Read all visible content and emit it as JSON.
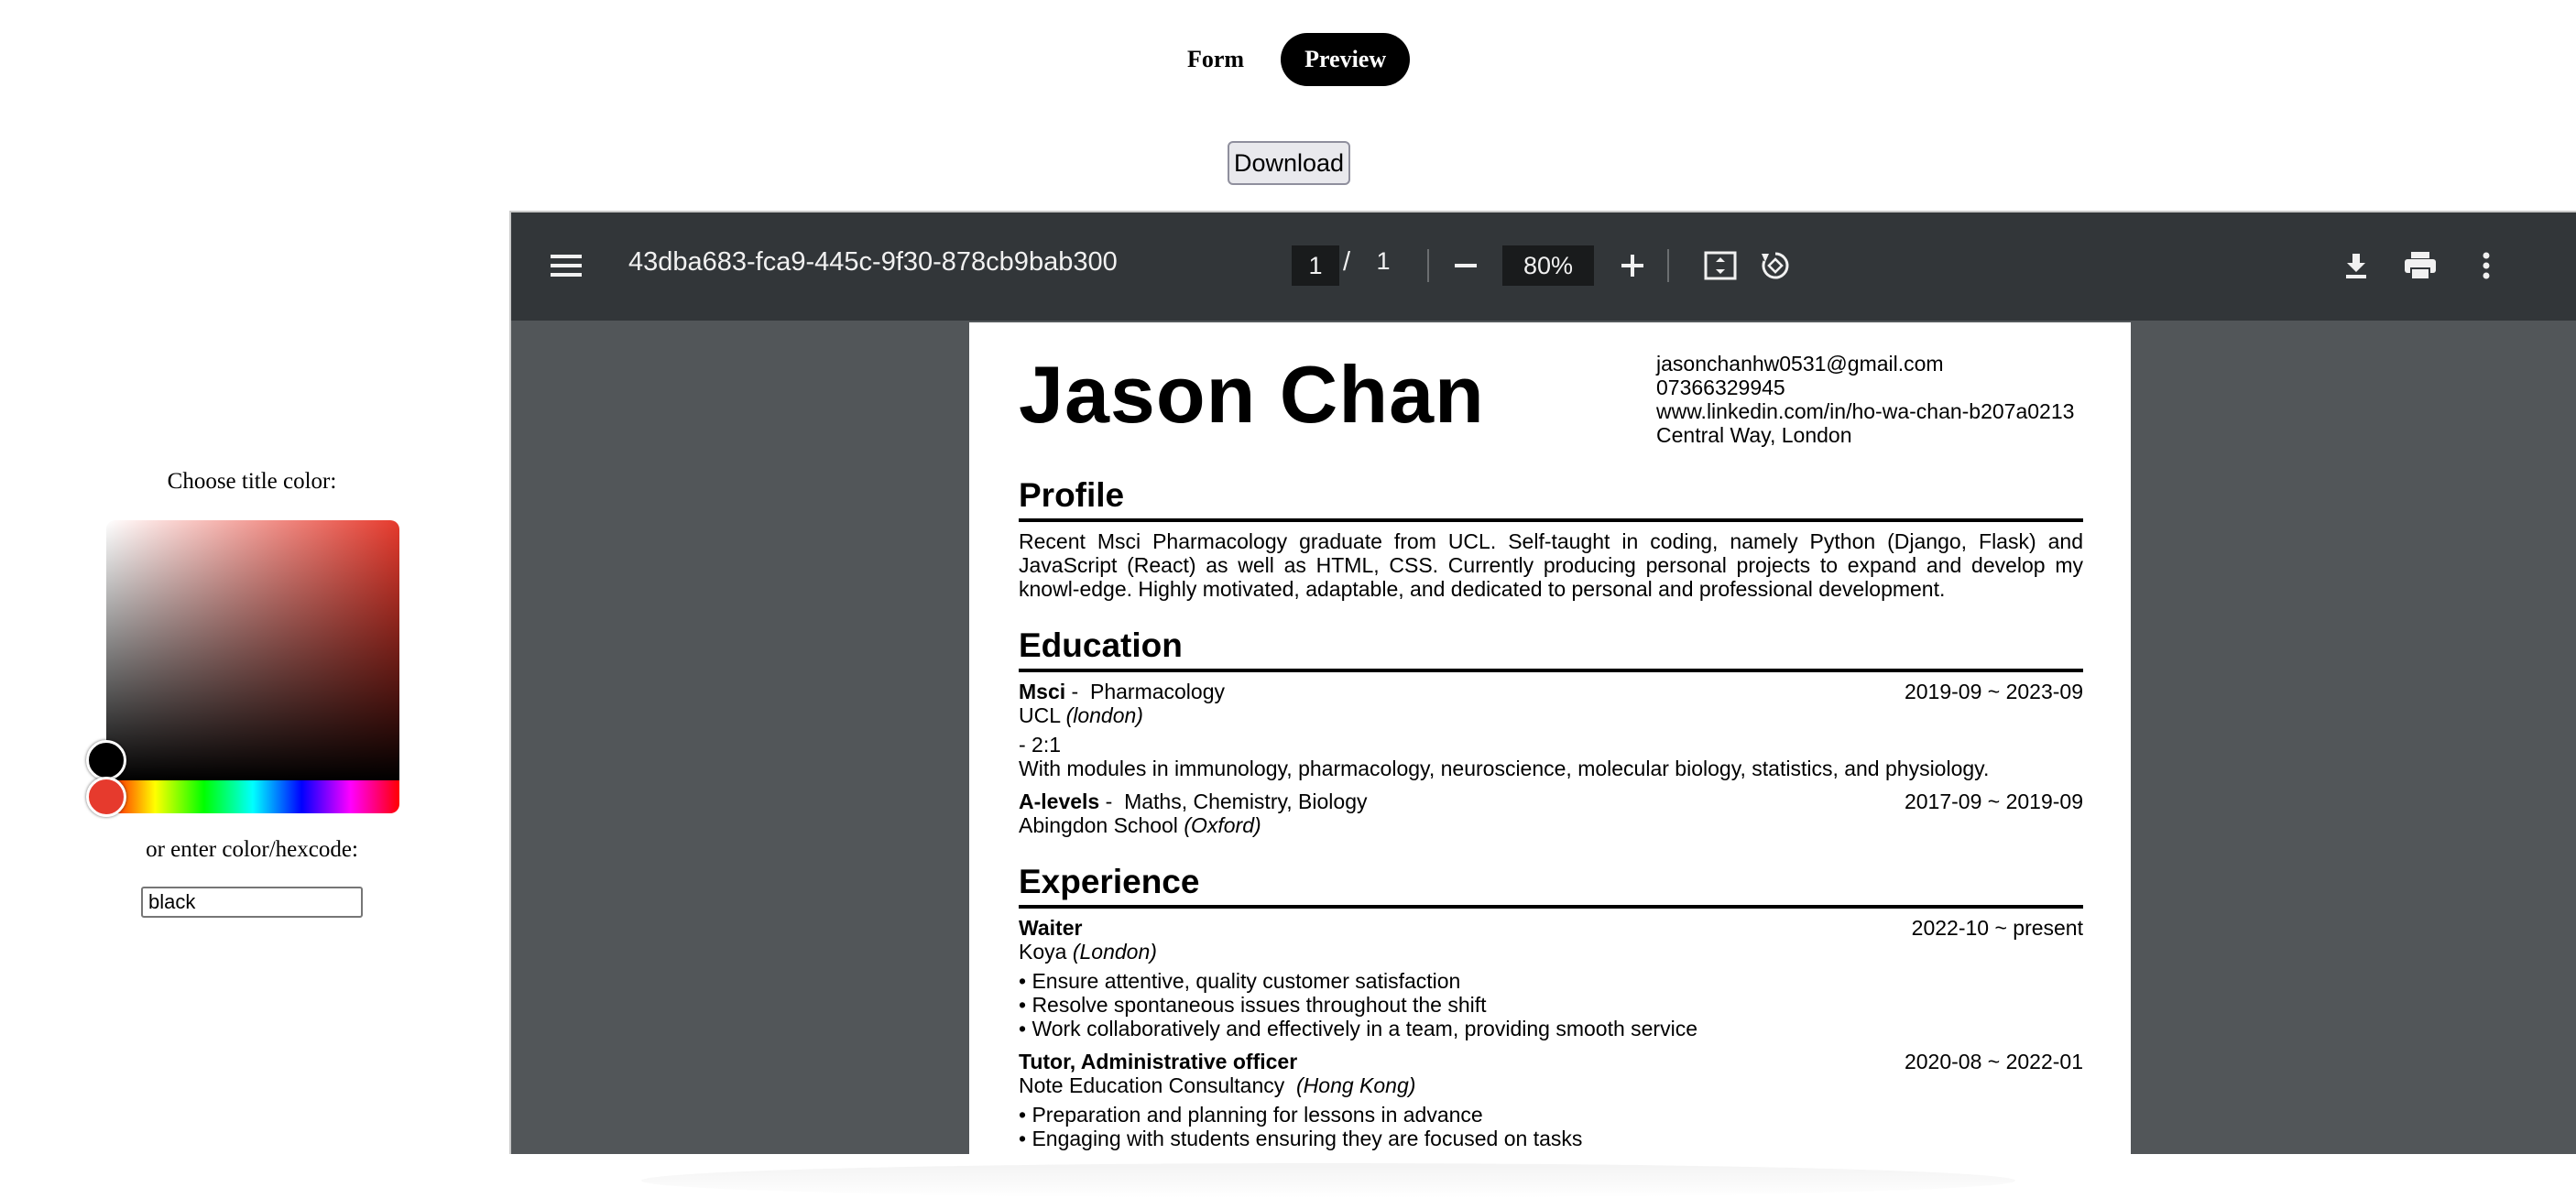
{
  "tabs": {
    "form": "Form",
    "preview": "Preview"
  },
  "download_label": "Download",
  "picker": {
    "title_label": "Choose title color:",
    "alt_label": "or enter color/hexcode:",
    "hex_value": "black",
    "hue_color": "#e63a2d"
  },
  "viewer": {
    "doc_title": "43dba683-fca9-445c-9f30-878cb9bab300",
    "page_current": "1",
    "page_sep": "/",
    "page_total": "1",
    "zoom": "80%"
  },
  "resume": {
    "name": "Jason Chan",
    "contact": {
      "email": "jasonchanhw0531@gmail.com",
      "phone": "07366329945",
      "linkedin": "www.linkedin.com/in/ho-wa-chan-b207a0213",
      "location": "Central Way, London"
    },
    "profile": {
      "title": "Profile",
      "text": "Recent Msci Pharmacology graduate from UCL. Self-taught in coding, namely Python (Django, Flask) and JavaScript (React) as well as HTML, CSS. Currently producing personal projects to expand and develop my knowl-edge. Highly motivated, adaptable, and dedicated to personal and professional development."
    },
    "education": {
      "title": "Education",
      "items": [
        {
          "degree": "Msci",
          "dash": " -  ",
          "subject": "Pharmacology",
          "dates": "2019-09 ~ 2023-09",
          "school": "UCL",
          "place": "(london)",
          "grade": "- 2:1",
          "note": "With modules in immunology, pharmacology, neuroscience, molecular biology, statistics, and physiology."
        },
        {
          "degree": "A-levels",
          "dash": " -  ",
          "subject": "Maths, Chemistry, Biology",
          "dates": "2017-09 ~ 2019-09",
          "school": "Abingdon School",
          "place": "(Oxford)"
        }
      ]
    },
    "experience": {
      "title": "Experience",
      "items": [
        {
          "role": "Waiter",
          "dates": "2022-10 ~ present",
          "org": "Koya",
          "place": "(London)",
          "bullets": [
            "• Ensure attentive, quality customer satisfaction",
            "• Resolve spontaneous issues throughout the shift",
            "• Work collaboratively and effectively in a team, providing smooth service"
          ]
        },
        {
          "role": "Tutor, Administrative officer",
          "dates": "2020-08 ~ 2022-01",
          "org": "Note Education Consultancy",
          "place": "(Hong Kong)",
          "bullets": [
            "• Preparation and planning for lessons in advance",
            "• Engaging with students ensuring they are focused on tasks"
          ]
        }
      ]
    }
  }
}
